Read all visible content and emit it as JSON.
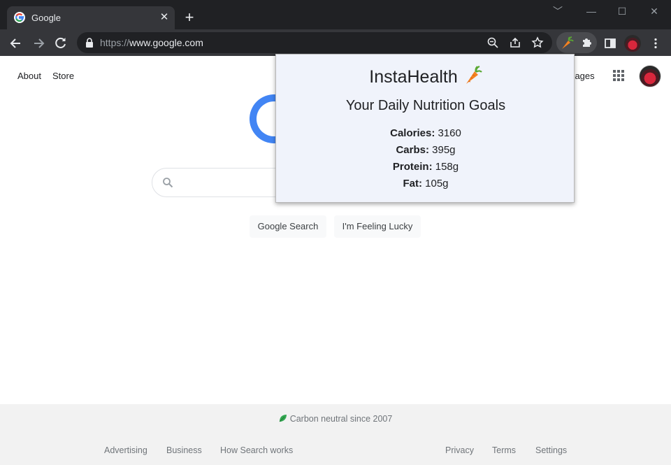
{
  "browser": {
    "tab_title": "Google",
    "tab_close": "✕",
    "new_tab": "+",
    "window_controls": [
      "﹀",
      "—",
      "☐",
      "✕"
    ],
    "url_prefix": "https://",
    "url_host": "www.google.com"
  },
  "page": {
    "top_left_links": [
      "About",
      "Store"
    ],
    "top_right_link": "Images",
    "buttons": [
      "Google Search",
      "I'm Feeling Lucky"
    ],
    "footer": {
      "carbon_text": "Carbon neutral since 2007",
      "left_links": [
        "Advertising",
        "Business",
        "How Search works"
      ],
      "right_links": [
        "Privacy",
        "Terms",
        "Settings"
      ]
    }
  },
  "popup": {
    "app_name": "InstaHealth",
    "heading": "Your Daily Nutrition Goals",
    "nutrients": [
      {
        "label": "Calories:",
        "value": "3160"
      },
      {
        "label": "Carbs:",
        "value": "395g"
      },
      {
        "label": "Protein:",
        "value": "158g"
      },
      {
        "label": "Fat:",
        "value": "105g"
      }
    ]
  },
  "colors": {
    "chrome_dark": "#202124",
    "toolbar": "#35363a",
    "popup_bg": "#f0f3fb",
    "google_blue": "#4285f4",
    "carrot_orange": "#f58220",
    "carrot_green": "#5aa832"
  }
}
